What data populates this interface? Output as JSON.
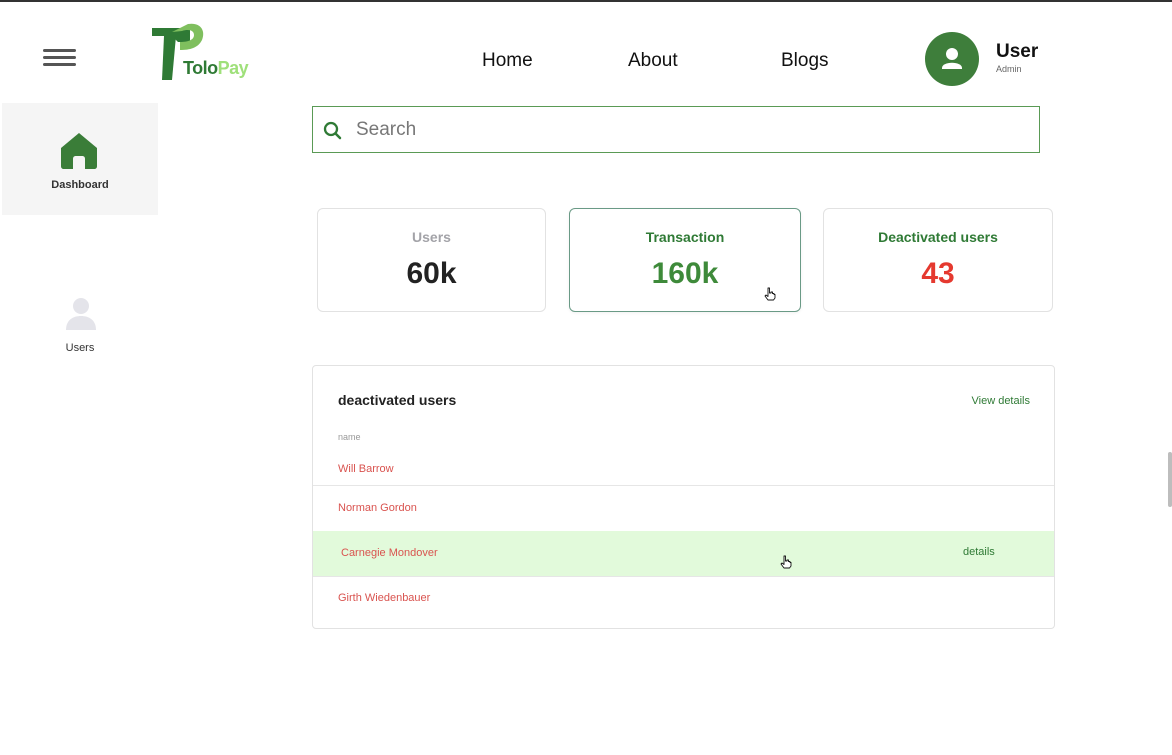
{
  "header": {
    "brand": {
      "part1": "Tolo",
      "part2": "Pay"
    },
    "nav": [
      {
        "label": "Home"
      },
      {
        "label": "About"
      },
      {
        "label": "Blogs"
      }
    ],
    "user": {
      "name": "User",
      "role": "Admin"
    }
  },
  "sidebar": {
    "items": [
      {
        "label": "Dashboard",
        "icon": "home-icon",
        "active": true
      },
      {
        "label": "Users",
        "icon": "user-icon",
        "active": false
      }
    ]
  },
  "search": {
    "placeholder": "Search",
    "value": ""
  },
  "stats": [
    {
      "label": "Users",
      "value": "60k",
      "label_color": "#a3a3a8",
      "value_color": "#222222"
    },
    {
      "label": "Transaction",
      "value": "160k",
      "label_color": "#2f7a35",
      "value_color": "#3e8a3a"
    },
    {
      "label": "Deactivated users",
      "value": "43",
      "label_color": "#2f7a35",
      "value_color": "#e5392f"
    }
  ],
  "deactivated": {
    "title": "deactivated users",
    "view_details": "View details",
    "column_header": "name",
    "row_action": "details",
    "rows": [
      {
        "name": "Will Barrow"
      },
      {
        "name": "Norman Gordon"
      },
      {
        "name": "Carnegie Mondover"
      },
      {
        "name": "Girth Wiedenbauer"
      }
    ]
  },
  "colors": {
    "brand_green": "#2f7a35",
    "brand_light_green": "#9fe07a",
    "danger_red": "#d9534f",
    "row_highlight": "#e2fadb"
  }
}
